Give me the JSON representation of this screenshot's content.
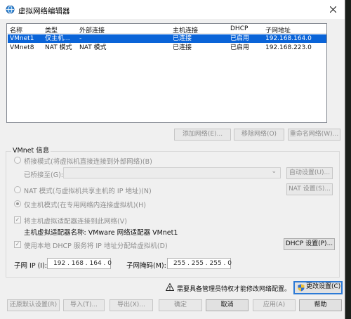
{
  "window": {
    "title": "虚拟网络编辑器"
  },
  "table": {
    "headers": [
      "名称",
      "类型",
      "外部连接",
      "主机连接",
      "DHCP",
      "子网地址"
    ],
    "rows": [
      [
        "VMnet1",
        "仅主机...",
        "-",
        "已连接",
        "已启用",
        "192.168.164.0"
      ],
      [
        "VMnet8",
        "NAT 模式",
        "NAT 模式",
        "已连接",
        "已启用",
        "192.168.223.0"
      ]
    ]
  },
  "table_buttons": {
    "add": "添加网络(E)...",
    "remove": "移除网络(O)",
    "rename": "重命名网络(W)..."
  },
  "info": {
    "group_label": "VMnet 信息",
    "bridge_mode": "桥接模式(将虚拟机直接连接到外部网络)(B)",
    "bridge_to_label": "已桥接至(G):",
    "bridge_to_value": "",
    "auto_settings": "自动设置(U)...",
    "nat_mode": "NAT 模式(与虚拟机共享主机的 IP 地址)(N)",
    "nat_settings": "NAT 设置(S)...",
    "host_only_mode": "仅主机模式(在专用网络内连接虚拟机)(H)",
    "connect_adapter": "将主机虚拟适配器连接到此网络(V)",
    "adapter_name": "主机虚拟适配器名称: VMware 网络适配器 VMnet1",
    "dhcp_local": "使用本地 DHCP 服务将 IP 地址分配给虚拟机(D)",
    "dhcp_settings": "DHCP 设置(P)...",
    "subnet_ip_label": "子网 IP (I):",
    "subnet_ip": "192 . 168 . 164 . 0",
    "subnet_mask_label": "子网掩码(M):",
    "subnet_mask": "255 . 255 . 255 . 0"
  },
  "admin_notice": "需要具备管理员特权才能修改网络配置。",
  "change_settings": "更改设置(C)",
  "footer": {
    "restore_defaults": "还原默认设置(R)",
    "import": "导入(T)...",
    "export": "导出(X)...",
    "ok": "确定",
    "cancel": "取消",
    "apply": "应用(A)",
    "help": "帮助"
  },
  "colors": {
    "selection": "#0a64d8",
    "window_bg": "#f0f0f0",
    "desktop_bg": "#1b1f1b"
  }
}
